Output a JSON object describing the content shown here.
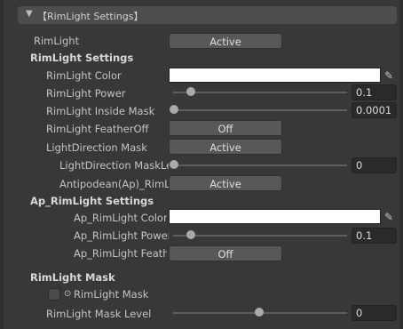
{
  "header": {
    "arrow": "▼",
    "title": "【RimLight Settings】"
  },
  "rimlight_toggle": {
    "label": "RimLight",
    "value": "Active"
  },
  "rimlight_settings": {
    "heading": "RimLight Settings",
    "color_label": "RimLight Color",
    "color_value": "#ffffff",
    "power": {
      "label": "RimLight Power",
      "value": "0.1",
      "slider_fraction": 0.1
    },
    "inside_mask": {
      "label": "RimLight Inside Mask",
      "value": "0.0001",
      "slider_fraction": 0.0001
    },
    "feather_off": {
      "label": "RimLight FeatherOff",
      "value": "Off"
    },
    "light_direction_mask": {
      "label": "LightDirection Mask",
      "value": "Active"
    },
    "light_direction_mask_level": {
      "label": "LightDirection MaskLevel",
      "value": "0",
      "slider_fraction": 0.0
    },
    "antipodean": {
      "label": "Antipodean(Ap)_RimLight",
      "value": "Active"
    }
  },
  "ap_rimlight_settings": {
    "heading": "Ap_RimLight Settings",
    "color_label": "Ap_RimLight Color",
    "color_value": "#ffffff",
    "power": {
      "label": "Ap_RimLight Power",
      "value": "0.1",
      "slider_fraction": 0.1
    },
    "feather_off": {
      "label": "Ap_RimLight FeatherOff",
      "value": "Off"
    }
  },
  "rimlight_mask": {
    "heading": "RimLight Mask",
    "texture_label": "RimLight Mask",
    "level": {
      "label": "RimLight Mask Level",
      "value": "0",
      "slider_fraction": 0.5
    }
  },
  "icons": {
    "picker": "eyedropper-icon",
    "object_picker": "circle-dot-icon"
  }
}
